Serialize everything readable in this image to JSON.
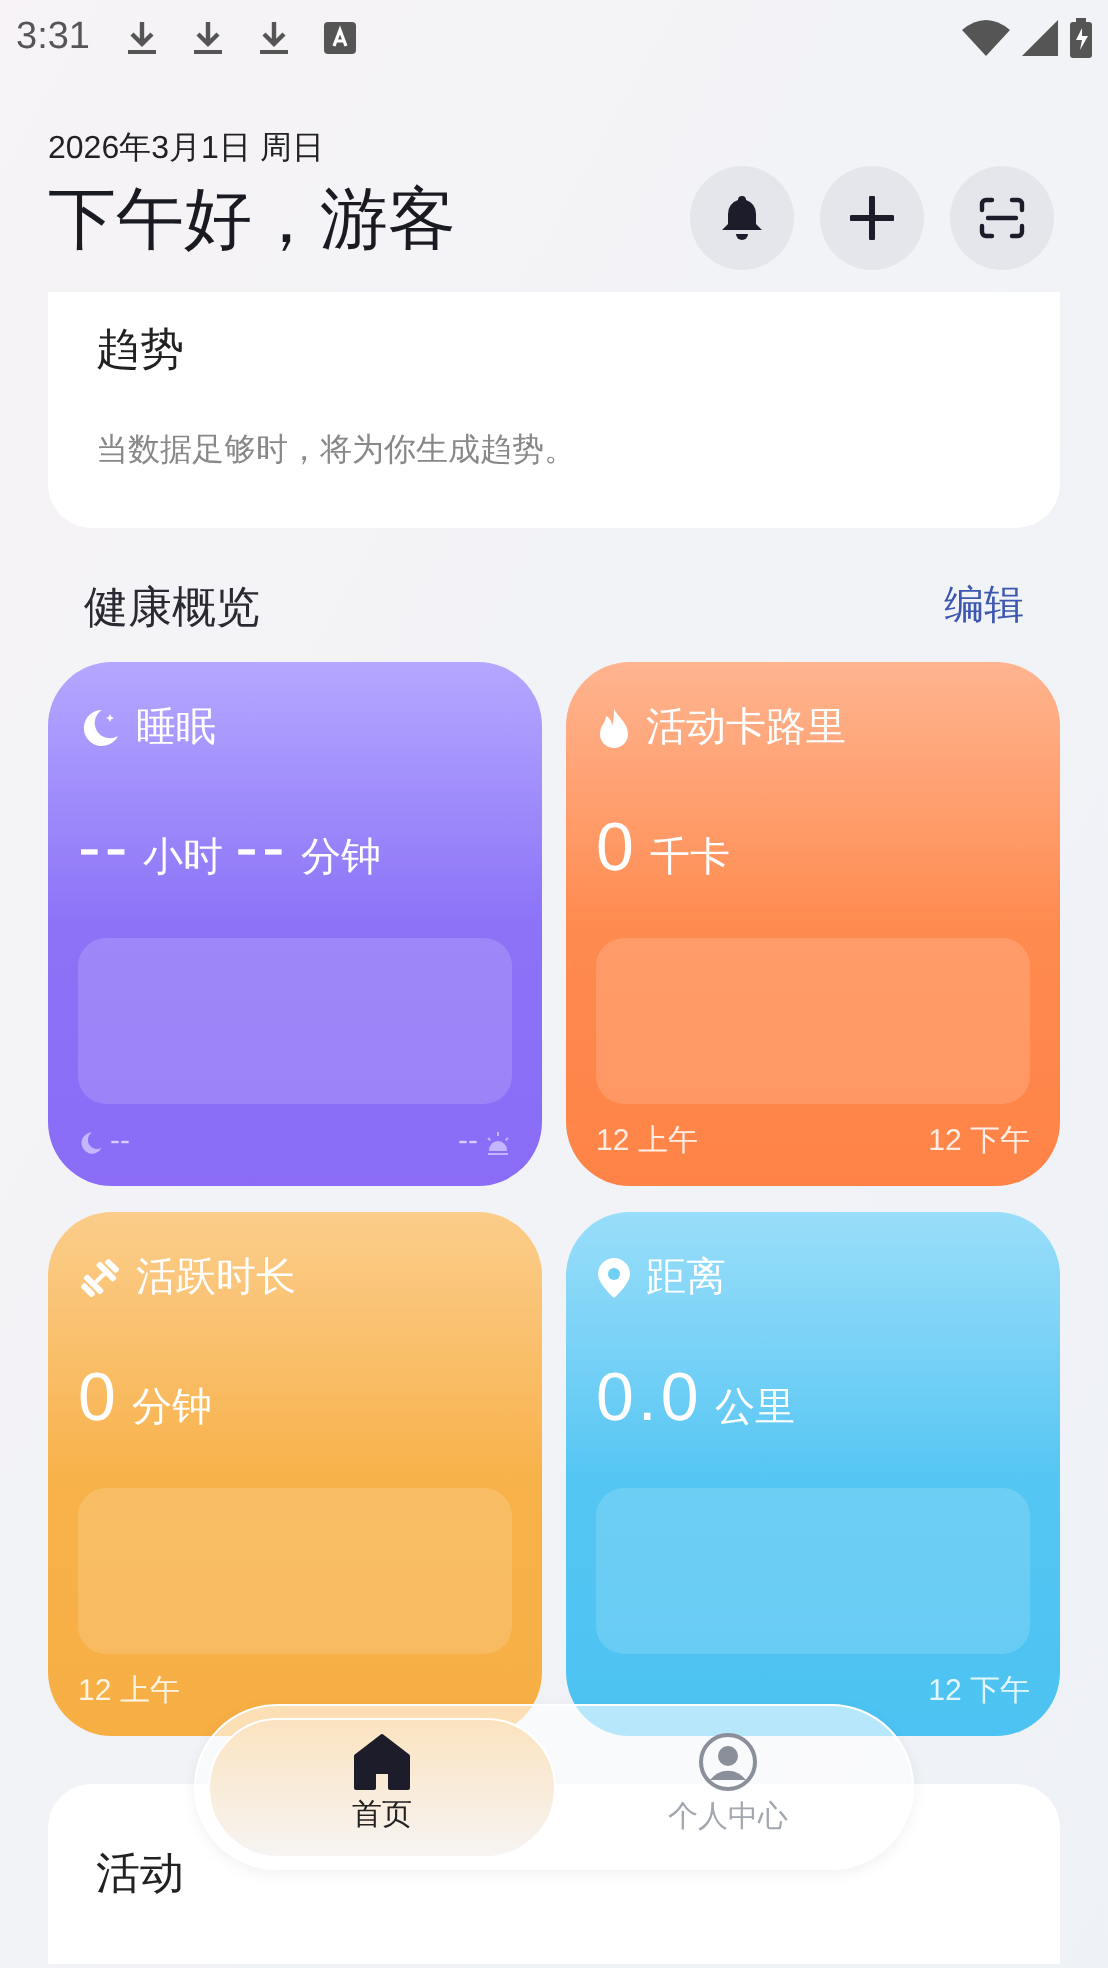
{
  "status_bar": {
    "time": "3:31",
    "notification_icons": [
      {
        "kind": "download"
      },
      {
        "kind": "download"
      },
      {
        "kind": "download"
      },
      {
        "kind": "text"
      }
    ]
  },
  "header": {
    "date": "2026年3月1日 周日",
    "greeting": "下午好，游客",
    "actions": [
      {
        "kind": "bell"
      },
      {
        "kind": "plus"
      },
      {
        "kind": "scan"
      }
    ]
  },
  "trend": {
    "title": "趋势",
    "message": "当数据足够时，将为你生成趋势。"
  },
  "overview": {
    "title": "健康概览",
    "edit": "编辑",
    "cards": [
      {
        "kind": "sleep",
        "title": "睡眠",
        "values": [
          {
            "number": "--",
            "unit": "小时"
          },
          {
            "number": "--",
            "unit": "分钟"
          }
        ],
        "footer_start": "--",
        "footer_end": "--"
      },
      {
        "kind": "calories",
        "title": "活动卡路里",
        "values": [
          {
            "number": "0",
            "unit": "千卡"
          }
        ],
        "footer_start": "12 上午",
        "footer_end": "12 下午"
      },
      {
        "kind": "active",
        "title": "活跃时长",
        "values": [
          {
            "number": "0",
            "unit": "分钟"
          }
        ],
        "footer_start": "12 上午"
      },
      {
        "kind": "distance",
        "title": "距离",
        "values": [
          {
            "number": "0.0",
            "unit": "公里"
          }
        ],
        "footer_end": "12 下午"
      }
    ]
  },
  "activity": {
    "title": "活动"
  },
  "bottom_nav": [
    {
      "kind": "home",
      "label": "首页",
      "selected": true
    },
    {
      "kind": "profile",
      "label": "个人中心",
      "selected": false
    }
  ]
}
